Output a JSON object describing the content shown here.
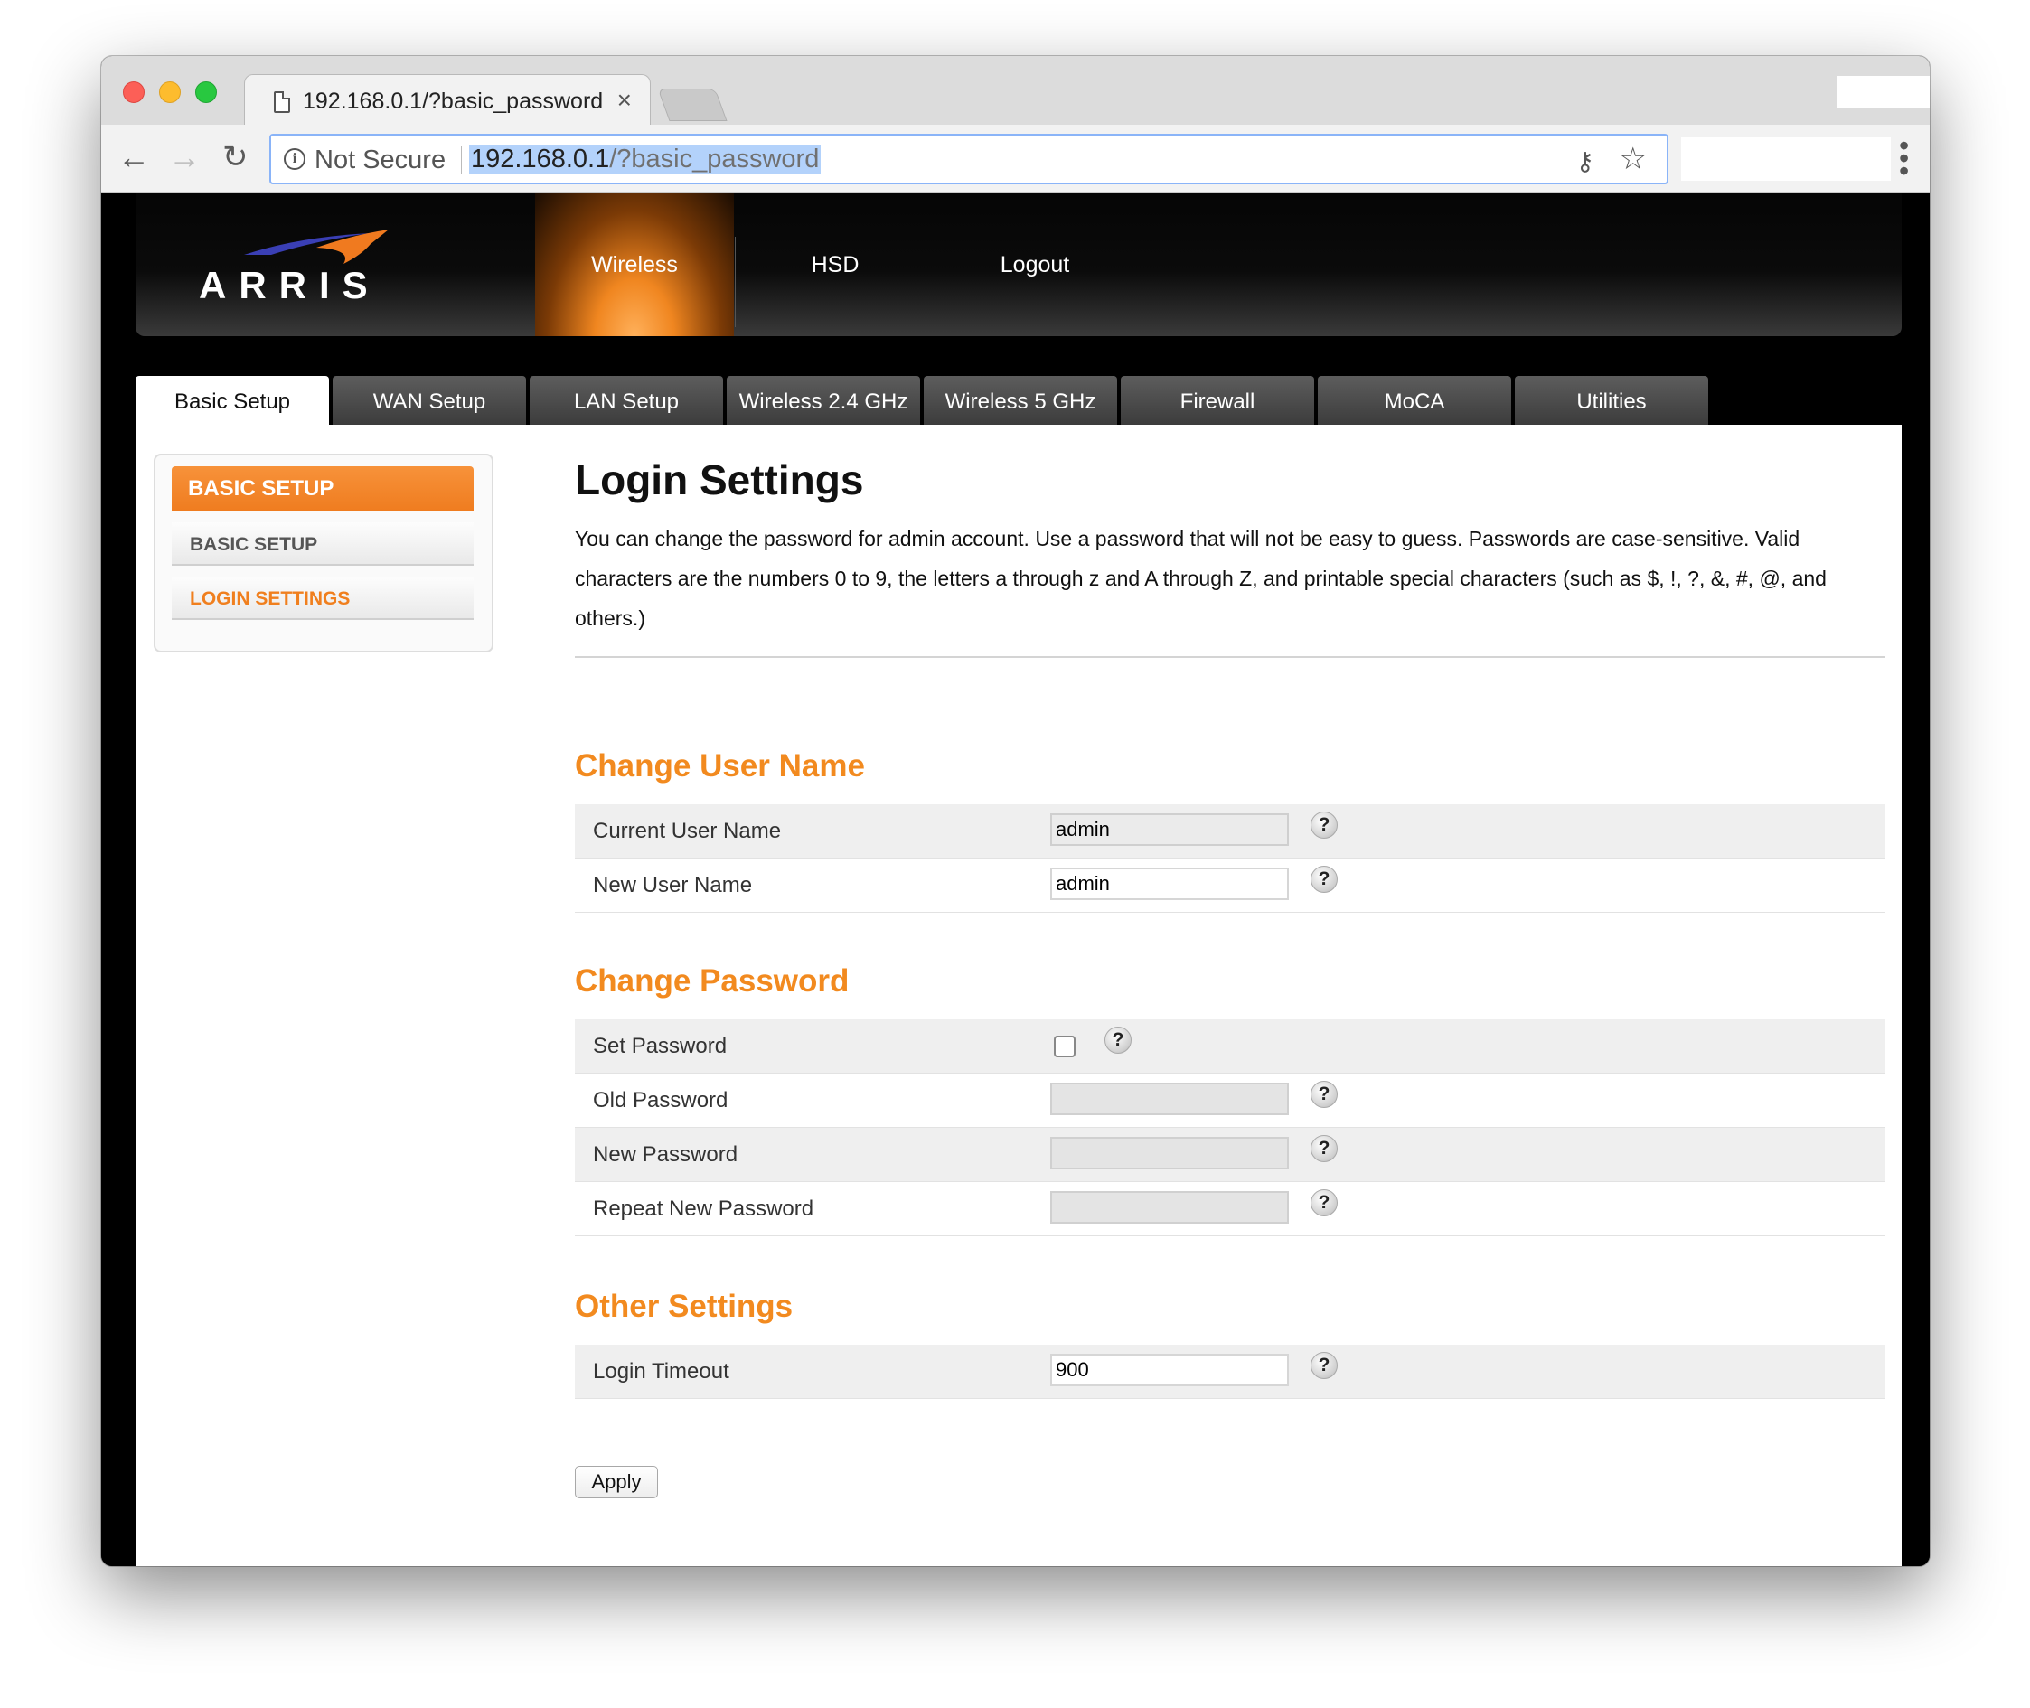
{
  "browser": {
    "tab_title": "192.168.0.1/?basic_password",
    "security_label": "Not Secure",
    "url_host": "192.168.0.1",
    "url_path": "/?basic_password"
  },
  "header": {
    "brand": "ARRIS",
    "nav": [
      "Wireless",
      "HSD",
      "Logout"
    ],
    "active_nav": "Wireless"
  },
  "tabs": [
    "Basic Setup",
    "WAN Setup",
    "LAN Setup",
    "Wireless 2.4 GHz",
    "Wireless 5 GHz",
    "Firewall",
    "MoCA",
    "Utilities"
  ],
  "sidebar": {
    "heading": "BASIC SETUP",
    "items": [
      "BASIC SETUP",
      "LOGIN SETTINGS"
    ],
    "active_item": "LOGIN SETTINGS"
  },
  "page": {
    "title": "Login Settings",
    "intro": "You can change the password for admin account. Use a password that will not be easy to guess. Passwords are case-sensitive. Valid characters are the numbers 0 to 9, the letters a through z and A through Z, and printable special characters (such as $, !, ?, &, #, @, and others.)"
  },
  "username_section": {
    "title": "Change User Name",
    "current_label": "Current User Name",
    "current_value": "admin",
    "new_label": "New User Name",
    "new_value": "admin"
  },
  "password_section": {
    "title": "Change Password",
    "set_label": "Set Password",
    "set_checked": false,
    "old_label": "Old Password",
    "new_label": "New Password",
    "repeat_label": "Repeat New Password"
  },
  "other_section": {
    "title": "Other Settings",
    "timeout_label": "Login Timeout",
    "timeout_value": "900"
  },
  "help_glyph": "?",
  "apply_label": "Apply",
  "colors": {
    "accent_orange": "#f28a1f",
    "sidebar_head": "#ef7c1f",
    "header_bg": "#000000"
  }
}
